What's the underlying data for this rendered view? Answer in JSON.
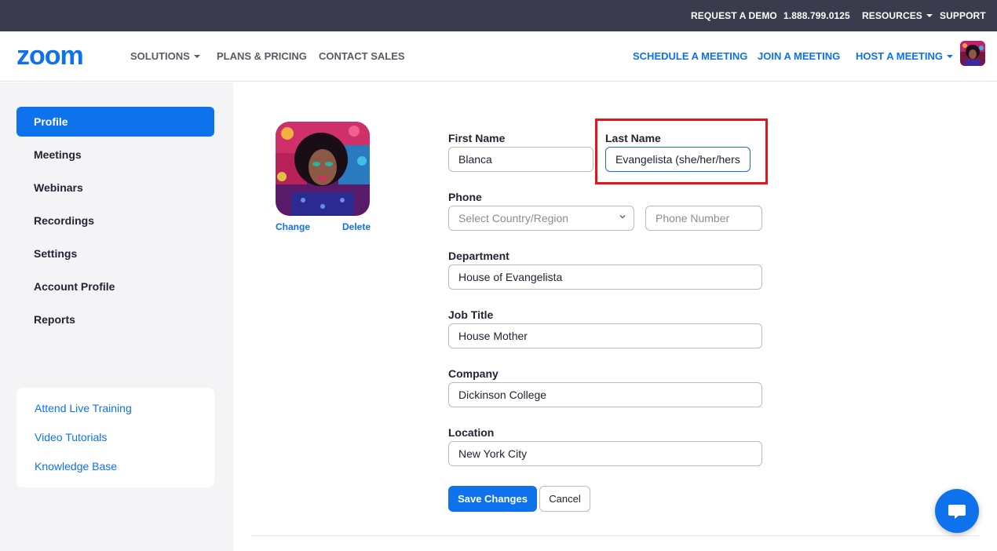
{
  "topbar": {
    "request_demo": "REQUEST A DEMO",
    "phone": "1.888.799.0125",
    "resources": "RESOURCES",
    "support": "SUPPORT"
  },
  "header": {
    "logo_text": "zoom",
    "nav_left": [
      "SOLUTIONS",
      "PLANS & PRICING",
      "CONTACT SALES"
    ],
    "nav_right": [
      "SCHEDULE A MEETING",
      "JOIN A MEETING",
      "HOST A MEETING"
    ]
  },
  "sidebar": {
    "items": [
      {
        "label": "Profile",
        "active": true
      },
      {
        "label": "Meetings",
        "active": false
      },
      {
        "label": "Webinars",
        "active": false
      },
      {
        "label": "Recordings",
        "active": false
      },
      {
        "label": "Settings",
        "active": false
      },
      {
        "label": "Account Profile",
        "active": false
      },
      {
        "label": "Reports",
        "active": false
      }
    ],
    "help_links": [
      "Attend Live Training",
      "Video Tutorials",
      "Knowledge Base"
    ]
  },
  "profile_photo": {
    "change_label": "Change",
    "delete_label": "Delete"
  },
  "form": {
    "first_name": {
      "label": "First Name",
      "value": "Blanca"
    },
    "last_name": {
      "label": "Last Name",
      "value": "Evangelista (she/her/hers)"
    },
    "phone": {
      "label": "Phone",
      "country_placeholder": "Select Country/Region",
      "number_placeholder": "Phone Number"
    },
    "department": {
      "label": "Department",
      "value": "House of Evangelista"
    },
    "job_title": {
      "label": "Job Title",
      "value": "House Mother"
    },
    "company": {
      "label": "Company",
      "value": "Dickinson College"
    },
    "location": {
      "label": "Location",
      "value": "New York City"
    },
    "save_label": "Save Changes",
    "cancel_label": "Cancel"
  },
  "icons": {
    "header_caret": "caret-down-icon",
    "select_chevron": "chevron-down-icon",
    "chat": "chat-bubble-icon"
  },
  "colors": {
    "accent": "#0e72ed",
    "topbar_bg": "#3a3b4c",
    "sidebar_bg": "#f4f4f6",
    "highlight": "#e8121c"
  }
}
